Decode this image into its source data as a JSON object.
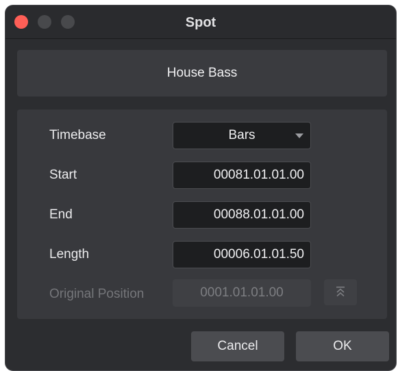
{
  "window": {
    "title": "Spot"
  },
  "clip": {
    "name": "House Bass"
  },
  "timebase": {
    "label": "Timebase",
    "value": "Bars"
  },
  "start": {
    "label": "Start",
    "value": "00081.01.01.00"
  },
  "end": {
    "label": "End",
    "value": "00088.01.01.00"
  },
  "length": {
    "label": "Length",
    "value": "00006.01.01.50"
  },
  "original": {
    "label": "Original Position",
    "value": "0001.01.01.00",
    "icon": "double-chevron-up-icon"
  },
  "buttons": {
    "cancel": "Cancel",
    "ok": "OK"
  },
  "colors": {
    "close": "#ff5f57",
    "background": "#2c2d30",
    "panel": "#38393d"
  }
}
